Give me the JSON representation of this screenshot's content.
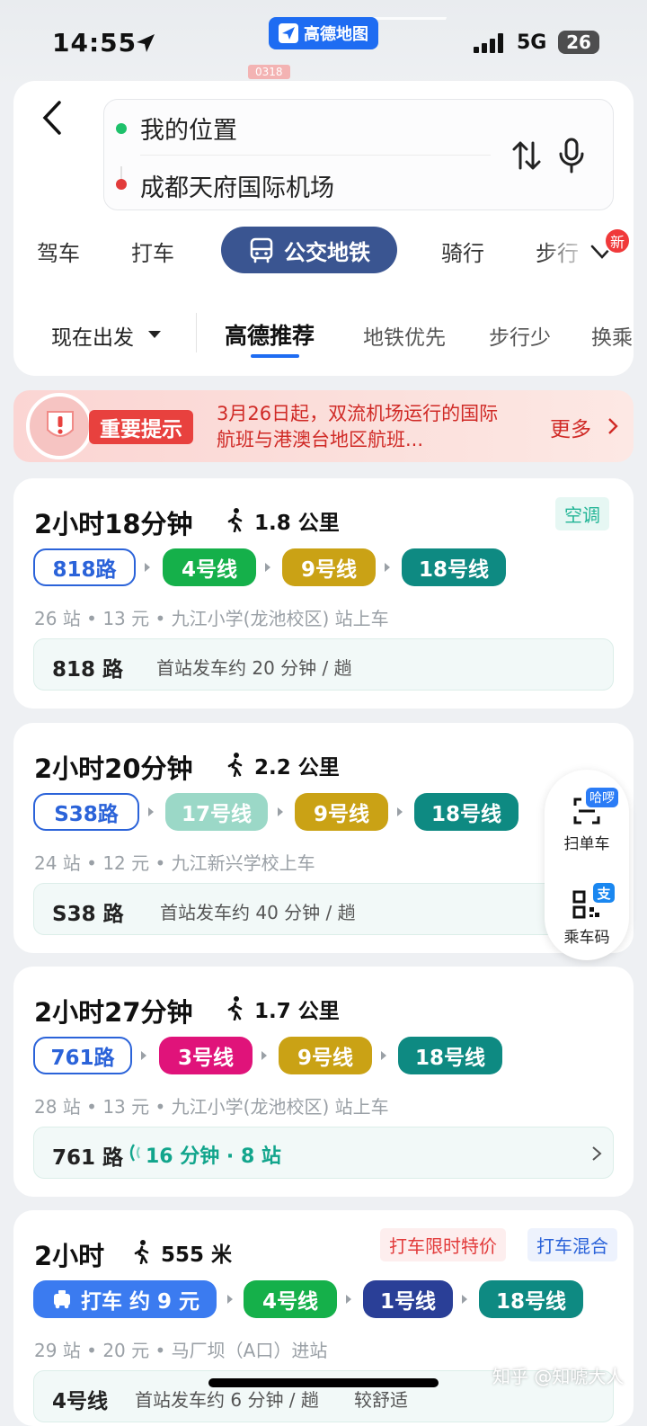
{
  "status": {
    "time": "14:55",
    "app_badge": "高德地图",
    "network": "5G",
    "battery": "26"
  },
  "search": {
    "from": "我的位置",
    "to": "成都天府国际机场"
  },
  "modes": {
    "drive": "驾车",
    "taxi": "打车",
    "transit": "公交地铁",
    "ride": "骑行",
    "walk": "步行",
    "new_badge": "新"
  },
  "filters": {
    "depart": "现在出发",
    "recommend": "高德推荐",
    "subway_first": "地铁优先",
    "less_walk": "步行少",
    "transfer": "换乘"
  },
  "notice": {
    "label": "重要提示",
    "text": "3月26日起，双流机场运行的国际航班与港澳台地区航班...",
    "more": "更多"
  },
  "routes": [
    {
      "time": "2小时18分钟",
      "walk": "1.8 公里",
      "tag": "空调",
      "segments": [
        "818路",
        "4号线",
        "9号线",
        "18号线"
      ],
      "info": "26 站 • 13 元 • 九江小学(龙池校区) 站上车",
      "detail_line": "818 路",
      "detail_text": "首站发车约 20 分钟 / 趟"
    },
    {
      "time": "2小时20分钟",
      "walk": "2.2 公里",
      "segments": [
        "S38路",
        "17号线",
        "9号线",
        "18号线"
      ],
      "info": "24 站 • 12 元 • 九江新兴学校上车",
      "detail_line": "S38 路",
      "detail_text": "首站发车约 40 分钟 / 趟"
    },
    {
      "time": "2小时27分钟",
      "walk": "1.7 公里",
      "segments": [
        "761路",
        "3号线",
        "9号线",
        "18号线"
      ],
      "info": "28 站 • 13 元 • 九江小学(龙池校区) 站上车",
      "detail_line": "761 路",
      "detail_text": "16 分钟 · 8 站"
    },
    {
      "time": "2小时",
      "walk": "555 米",
      "tag_red": "打车限时特价",
      "tag_blue": "打车混合",
      "segments": [
        "打车 约 9 元",
        "4号线",
        "1号线",
        "18号线"
      ],
      "info": "29 站 • 20 元 • 马厂坝（A口）进站",
      "detail_line": "4号线",
      "detail_text": "首站发车约 6 分钟 / 趟",
      "detail_extra": "较舒适"
    }
  ],
  "float": {
    "scan_label": "扫单车",
    "scan_badge": "哈啰",
    "code_label": "乘车码",
    "code_badge": "支"
  },
  "watermark": "知乎 @知唬大人",
  "colors": {
    "line4": "#15b04a",
    "line9": "#caa215",
    "line18": "#0e8a82",
    "line17": "#9bd8c7",
    "line3": "#e0137a",
    "line1": "#2a3f97",
    "accent": "#1e6cf2"
  }
}
